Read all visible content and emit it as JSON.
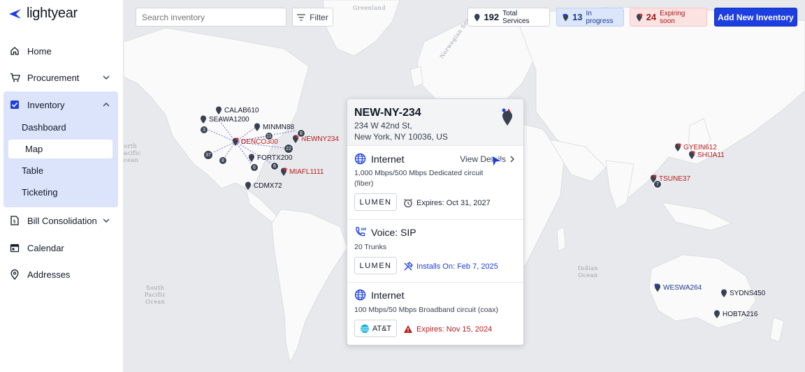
{
  "brand": {
    "name": "lightyear",
    "accent": "#1d3fe0"
  },
  "sidebar": {
    "items": [
      {
        "label": "Home",
        "icon": "home-icon"
      },
      {
        "label": "Procurement",
        "icon": "cart-icon"
      },
      {
        "label": "Inventory",
        "icon": "checkbox-icon"
      },
      {
        "label": "Bill Consolidation",
        "icon": "bill-icon"
      },
      {
        "label": "Calendar",
        "icon": "calendar-icon"
      },
      {
        "label": "Addresses",
        "icon": "location-icon"
      }
    ],
    "inventory_sub": [
      {
        "label": "Dashboard"
      },
      {
        "label": "Map",
        "active": true
      },
      {
        "label": "Table"
      },
      {
        "label": "Ticketing"
      }
    ]
  },
  "toolbar": {
    "search_placeholder": "Search inventory",
    "filter_label": "Filter",
    "stats": {
      "total_count": "192",
      "total_label": "Total Services",
      "progress_count": "13",
      "progress_label": "In progress",
      "expiring_count": "24",
      "expiring_label": "Expiring soon"
    },
    "add_label": "Add New Inventory"
  },
  "map": {
    "ocean_labels": {
      "greenland": "Greenland",
      "norwegian_sea": "Norwegian Sea",
      "north_pacific": "orth\nacific\ncean",
      "south_pacific": "South\nPacific\nOcean",
      "indian_ocean": "Indian\nOcean"
    },
    "pins": {
      "calab610": "CALAB610",
      "seawa1200": "SEAWA1200",
      "minmn88": "MINMN88",
      "newny234": "NEWNY234",
      "denco300": "DENCO300",
      "fortx200": "FORTX200",
      "miafl1111": "MIAFL1111",
      "cdmx72": "CDMX72",
      "gyein612": "GYEIN612",
      "shija11": "SHIJA11",
      "tsune37": "TSUNE37",
      "weswa264": "WESWA264",
      "sydns450": "SYDNS450",
      "hobta216": "HOBTA216"
    },
    "clusters": {
      "c1": "3",
      "c2": "11",
      "c3": "8",
      "c4": "22",
      "c5": "37",
      "c6": "8",
      "c7": "6",
      "c8": "8",
      "c9": "7"
    }
  },
  "popup": {
    "site_id": "NEW-NY-234",
    "address_line1": "234 W 42nd St,",
    "address_line2": "New York, NY 10036, US",
    "services": [
      {
        "type": "Internet",
        "icon": "globe-icon",
        "view_details": "View Details",
        "description": "1,000 Mbps/500 Mbps Dedicated circuit (fiber)",
        "vendor": "LUMEN",
        "note_icon": "alarm-clock-icon",
        "note": "Expires: Oct 31, 2027",
        "note_color": "#1f2937"
      },
      {
        "type": "Voice: SIP",
        "icon": "sip-phone-icon",
        "description": "20 Trunks",
        "vendor": "LUMEN",
        "note_icon": "tools-icon",
        "note": "Installs On: Feb 7, 2025",
        "note_color": "#1d3fe0"
      },
      {
        "type": "Internet",
        "icon": "globe-icon",
        "description": "100 Mbps/50 Mbps Broadband circuit (coax)",
        "vendor": "AT&T",
        "note_icon": "warning-icon",
        "note": "Expires: Nov 15, 2024",
        "note_color": "#b91c1c"
      }
    ]
  }
}
